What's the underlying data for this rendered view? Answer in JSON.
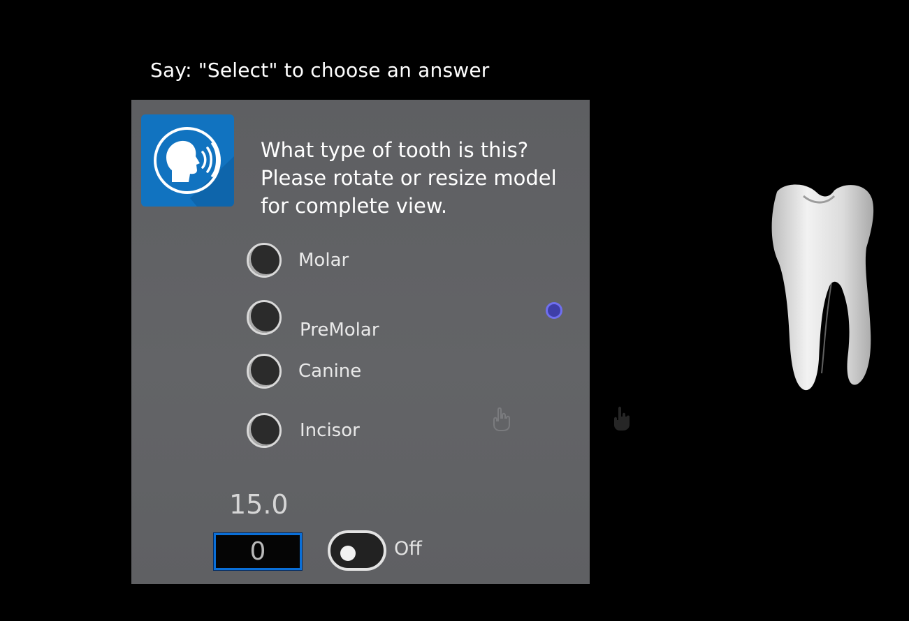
{
  "instruction": "Say: \"Select\" to choose an answer",
  "question": {
    "lines": [
      "What type of tooth is this?",
      "Please rotate or resize model",
      "for complete view."
    ]
  },
  "options": [
    {
      "label": "Molar",
      "selected": false
    },
    {
      "label": "PreMolar",
      "selected": false
    },
    {
      "label": "Canine",
      "selected": false
    },
    {
      "label": "Incisor",
      "selected": false
    }
  ],
  "timer": "15.0",
  "number_field": "0",
  "toggle": {
    "label": "Off",
    "on": false
  },
  "icons": {
    "speech": "speaking-head-icon",
    "pointer": "gaze-pointer-icon",
    "hand_faint": "hand-icon",
    "hand_cursor": "hand-cursor-icon"
  },
  "colors": {
    "panel": "#5f6063",
    "speech_tile": "#1173c0",
    "field_border": "#0a6fd8",
    "pointer": "#6f6ff0"
  }
}
